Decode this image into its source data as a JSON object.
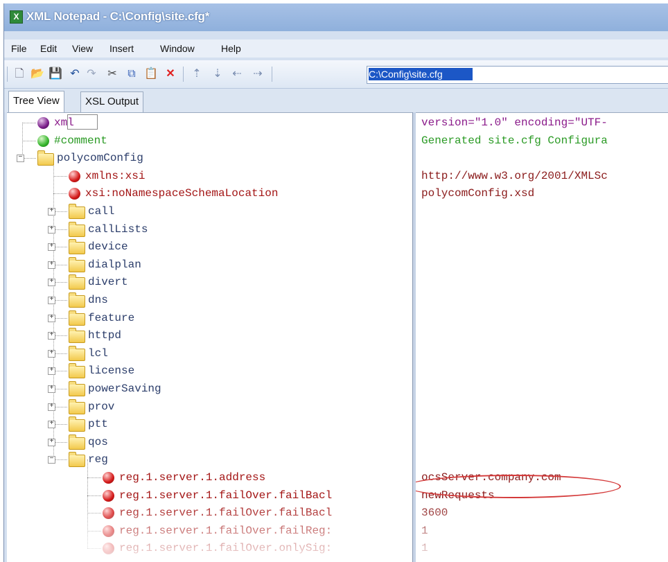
{
  "window": {
    "title": "XML Notepad - C:\\Config\\site.cfg*",
    "app_icon": "X"
  },
  "menu": [
    "File",
    "Edit",
    "View",
    "Insert",
    "Window",
    "Help"
  ],
  "toolbar": {
    "icons": [
      "new-file-icon",
      "open-folder-icon",
      "save-icon",
      "undo-icon",
      "redo-icon",
      "cut-icon",
      "copy-icon",
      "paste-icon",
      "delete-icon",
      "nudge-up-icon",
      "nudge-down-icon",
      "nudge-left-icon",
      "nudge-right-icon"
    ],
    "path_value": "C:\\Config\\site.cfg"
  },
  "tabs": {
    "tree_view": "Tree View",
    "xsl_output": "XSL Output"
  },
  "tree": [
    {
      "label": "xml",
      "type": "pi",
      "indent": 0,
      "expander": ""
    },
    {
      "label": "#comment",
      "type": "comment",
      "indent": 0,
      "expander": ""
    },
    {
      "label": "polycomConfig",
      "type": "folder",
      "indent": 0,
      "expander": "−"
    },
    {
      "label": "xmlns:xsi",
      "type": "attr",
      "indent": 1,
      "expander": ""
    },
    {
      "label": "xsi:noNamespaceSchemaLocation",
      "type": "attr",
      "indent": 1,
      "expander": ""
    },
    {
      "label": "call",
      "type": "folder",
      "indent": 1,
      "expander": "+"
    },
    {
      "label": "callLists",
      "type": "folder",
      "indent": 1,
      "expander": "+"
    },
    {
      "label": "device",
      "type": "folder",
      "indent": 1,
      "expander": "+"
    },
    {
      "label": "dialplan",
      "type": "folder",
      "indent": 1,
      "expander": "+"
    },
    {
      "label": "divert",
      "type": "folder",
      "indent": 1,
      "expander": "+"
    },
    {
      "label": "dns",
      "type": "folder",
      "indent": 1,
      "expander": "+"
    },
    {
      "label": "feature",
      "type": "folder",
      "indent": 1,
      "expander": "+"
    },
    {
      "label": "httpd",
      "type": "folder",
      "indent": 1,
      "expander": "+"
    },
    {
      "label": "lcl",
      "type": "folder",
      "indent": 1,
      "expander": "+"
    },
    {
      "label": "license",
      "type": "folder",
      "indent": 1,
      "expander": "+"
    },
    {
      "label": "powerSaving",
      "type": "folder",
      "indent": 1,
      "expander": "+"
    },
    {
      "label": "prov",
      "type": "folder",
      "indent": 1,
      "expander": "+"
    },
    {
      "label": "ptt",
      "type": "folder",
      "indent": 1,
      "expander": "+"
    },
    {
      "label": "qos",
      "type": "folder",
      "indent": 1,
      "expander": "+"
    },
    {
      "label": "reg",
      "type": "folder",
      "indent": 1,
      "expander": "−"
    },
    {
      "label": "reg.1.server.1.address",
      "type": "attr",
      "indent": 2,
      "expander": ""
    },
    {
      "label": "reg.1.server.1.failOver.failBacl",
      "type": "attr",
      "indent": 2,
      "expander": ""
    },
    {
      "label": "reg.1.server.1.failOver.failBacl",
      "type": "attr",
      "indent": 2,
      "expander": ""
    },
    {
      "label": "reg.1.server.1.failOver.failReg:",
      "type": "attr",
      "indent": 2,
      "expander": ""
    },
    {
      "label": "reg.1.server.1.failOver.onlySig:",
      "type": "attr",
      "indent": 2,
      "expander": ""
    }
  ],
  "values": [
    {
      "text": "version=\"1.0\" encoding=\"UTF-",
      "type": "pi"
    },
    {
      "text": "Generated site.cfg Configura",
      "type": "comment"
    },
    {
      "text": "",
      "type": "attr"
    },
    {
      "text": "http://www.w3.org/2001/XMLSc",
      "type": "attr"
    },
    {
      "text": "polycomConfig.xsd",
      "type": "attr"
    },
    {
      "text": "",
      "type": "attr"
    },
    {
      "text": "",
      "type": "attr"
    },
    {
      "text": "",
      "type": "attr"
    },
    {
      "text": "",
      "type": "attr"
    },
    {
      "text": "",
      "type": "attr"
    },
    {
      "text": "",
      "type": "attr"
    },
    {
      "text": "",
      "type": "attr"
    },
    {
      "text": "",
      "type": "attr"
    },
    {
      "text": "",
      "type": "attr"
    },
    {
      "text": "",
      "type": "attr"
    },
    {
      "text": "",
      "type": "attr"
    },
    {
      "text": "",
      "type": "attr"
    },
    {
      "text": "",
      "type": "attr"
    },
    {
      "text": "",
      "type": "attr"
    },
    {
      "text": "",
      "type": "attr"
    },
    {
      "text": "ocsServer.company.com",
      "type": "attr"
    },
    {
      "text": "newRequests",
      "type": "attr"
    },
    {
      "text": "3600",
      "type": "attr"
    },
    {
      "text": "1",
      "type": "attr"
    },
    {
      "text": "1",
      "type": "attr"
    }
  ],
  "colors": {
    "highlight_oval": "#d43a3a",
    "selection": "#1c57c6"
  }
}
